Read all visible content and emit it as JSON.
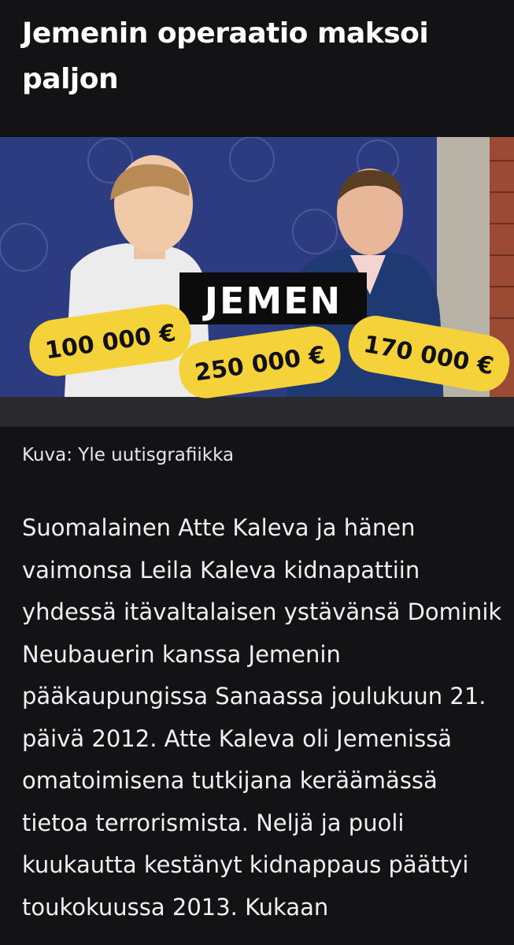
{
  "article": {
    "title": "Jemenin operaatio maksoi paljon",
    "image": {
      "banner_text": "JEMEN",
      "amounts": [
        "100 000 €",
        "250 000 €",
        "170 000 €"
      ],
      "colors": {
        "tag": "#f5d23a",
        "background": "#2d3c80",
        "banner": "#0c0c0c"
      }
    },
    "caption": "Kuva: Yle uutisgrafiikka",
    "body_text": "Suomalainen Atte Kaleva ja hänen vaimonsa Leila Kaleva kidnapattiin yhdessä itävaltalaisen ystävänsä Dominik Neubauerin kanssa Jemenin pääkaupungissa Sanaassa joulukuun 21. päivä 2012. Atte Kaleva oli Jemenissä omatoimisena tutkijana keräämässä tietoa terrorismista. Neljä ja puoli kuukautta kestänyt kidnappaus päättyi toukokuussa 2013. Kukaan"
  }
}
